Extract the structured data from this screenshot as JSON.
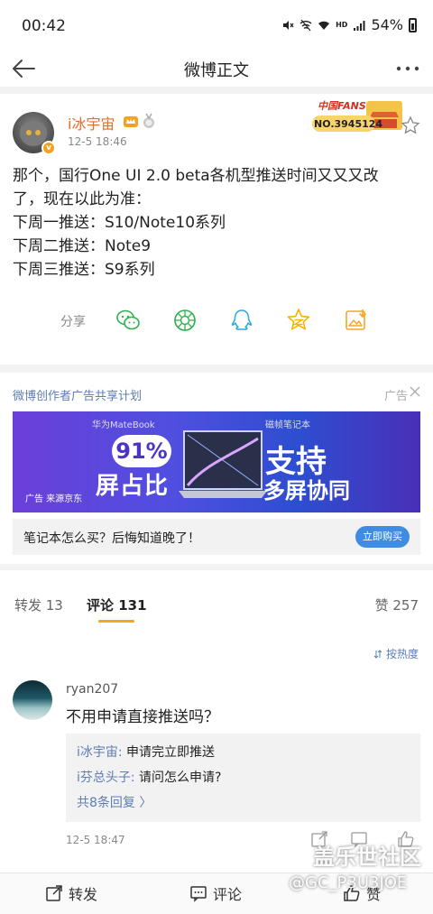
{
  "status_bar": {
    "time": "00:42",
    "battery": "54%",
    "hd": "HD"
  },
  "nav": {
    "title": "微博正文"
  },
  "post": {
    "username": "i冰宇宙",
    "time": "12-5 18:46",
    "fans_badge": {
      "title": "中国FANS",
      "number": "NO.3945124"
    },
    "text_lines": [
      "那个，国行One UI 2.0 beta各机型推送时间又又又改",
      "了，现在以此为准：",
      "下周一推送：S10/Note10系列",
      "下周二推送：Note9",
      "下周三推送：S9系列"
    ],
    "share_label": "分享",
    "share_targets": [
      "wechat-icon",
      "moments-icon",
      "qq-icon",
      "qzone-icon",
      "save-image-icon"
    ]
  },
  "ad": {
    "header": "微博创作者广告共享计划",
    "tag": "广告",
    "banner": {
      "sub1": "华为MateBook",
      "sub2": "磁帧笔记本",
      "percent": "91%",
      "big1": "屏占比",
      "big2": "支持",
      "big3": "多屏协同",
      "source": "广告 来源京东"
    },
    "footer_text": "笔记本怎么买？后悔知道晚了！",
    "button": "立即购买"
  },
  "tabs": {
    "repost": "转发 13",
    "comment": "评论 131",
    "like": "赞 257"
  },
  "sort_label": "按热度",
  "comment": {
    "name": "ryan207",
    "text": "不用申请直接推送吗？",
    "replies": [
      {
        "name": "i冰宇宙:",
        "text": " 申请完立即推送"
      },
      {
        "name": "i芬总头子:",
        "text": " 请问怎么申请?"
      }
    ],
    "more": "共8条回复 〉",
    "time": "12-5 18:47"
  },
  "bottom_bar": {
    "repost": "转发",
    "comment": "评论",
    "like": "赞"
  },
  "watermark": {
    "line1": "盖乐世社区",
    "line2": "@GC_P3U3JOE"
  },
  "colors": {
    "accent_orange": "#f5a623",
    "link_blue": "#5d7db3",
    "username_orange": "#e96b27",
    "buy_button": "#3f8ce3"
  }
}
